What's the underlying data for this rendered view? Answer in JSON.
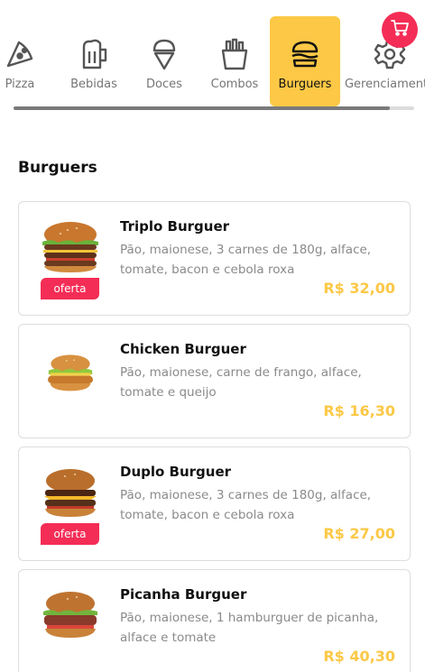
{
  "categories": [
    {
      "label": "Pizza",
      "icon": "pizza-icon",
      "active": false
    },
    {
      "label": "Bebidas",
      "icon": "beer-mug-icon",
      "active": false
    },
    {
      "label": "Doces",
      "icon": "ice-cream-icon",
      "active": false
    },
    {
      "label": "Combos",
      "icon": "fries-icon",
      "active": false
    },
    {
      "label": "Burguers",
      "icon": "burger-icon",
      "active": true
    },
    {
      "label": "Gerenciamento",
      "icon": "gear-icon",
      "active": false
    }
  ],
  "cart": {
    "icon": "cart-icon"
  },
  "colors": {
    "accent": "#fcc846",
    "brand": "#f42d56"
  },
  "section": {
    "title": "Burguers"
  },
  "products": [
    {
      "name": "Triplo Burguer",
      "description": "Pão, maionese, 3 carnes de 180g, alface, tomate, bacon e cebola roxa",
      "price": "R$ 32,00",
      "badge": "oferta"
    },
    {
      "name": "Chicken Burguer",
      "description": "Pão, maionese, carne de frango, alface, tomate e queijo",
      "price": "R$ 16,30",
      "badge": ""
    },
    {
      "name": "Duplo Burguer",
      "description": "Pão, maionese, 3 carnes de 180g, alface, tomate, bacon e cebola roxa",
      "price": "R$ 27,00",
      "badge": "oferta"
    },
    {
      "name": "Picanha Burguer",
      "description": "Pão, maionese, 1 hamburguer de picanha, alface e tomate",
      "price": "R$ 40,30",
      "badge": ""
    }
  ]
}
